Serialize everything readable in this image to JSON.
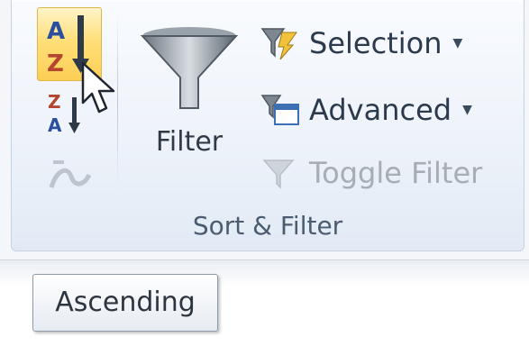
{
  "ribbon": {
    "group_label": "Sort & Filter",
    "sort_buttons": {
      "ascending_icon": "sort-a-to-z-icon",
      "descending_icon": "sort-z-to-a-icon",
      "custom_sort_icon": "custom-sort-icon",
      "ascending_top_letter": "A",
      "ascending_mid_letter": "Z",
      "descending_top_letter": "Z",
      "descending_mid_letter": "A"
    },
    "filter": {
      "label": "Filter",
      "icon": "funnel-icon"
    },
    "selection": {
      "label": "Selection",
      "icon": "selection-filter-icon"
    },
    "advanced": {
      "label": "Advanced",
      "icon": "advanced-filter-icon"
    },
    "toggle_filter": {
      "label": "Toggle Filter",
      "icon": "toggle-filter-icon"
    }
  },
  "tooltip": {
    "text": "Ascending"
  },
  "colors": {
    "highlight": "#ffdf7a",
    "highlight_border": "#e0b64c",
    "text": "#2b3a4c",
    "disabled": "#a7adb4"
  }
}
